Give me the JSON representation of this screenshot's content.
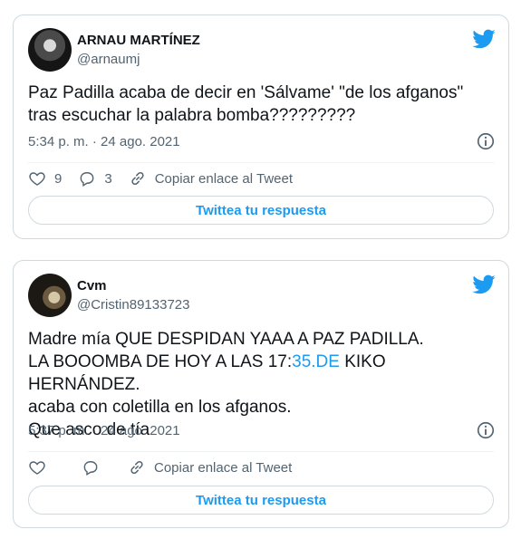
{
  "tweets": [
    {
      "author": "ARNAU MARTÍNEZ",
      "handle": "@arnaumj",
      "text": "Paz Padilla acaba de decir en 'Sálvame' \"de los afganos\"\ntras escuchar la palabra bomba?????????",
      "timestamp": "5:34 p. m. · 24 ago. 2021",
      "likes": "9",
      "replies": "3",
      "copy_link_label": "Copiar enlace al Tweet",
      "reply_button_label": "Twittea tu respuesta"
    },
    {
      "author": "Cvm",
      "handle": "@Cristin89133723",
      "text_before_link": "Madre mía QUE DESPIDAN YAAA A PAZ PADILLA.\nLA BOOOMBA DE HOY A LAS 17:",
      "link_text": "35.DE",
      "text_after_link": " KIKO HERNÁNDEZ.\nacaba con coletilla en los afganos.\nQue asco de tía",
      "timestamp": "5:37 p. m. · 24 ago. 2021",
      "copy_link_label": "Copiar enlace al Tweet",
      "reply_button_label": "Twittea tu respuesta"
    }
  ],
  "colors": {
    "accent": "#1d9bf0",
    "secondary_text": "#536471",
    "border": "#cfd9de"
  },
  "icons": [
    "twitter-bird-icon",
    "info-icon",
    "heart-icon",
    "reply-icon",
    "link-icon"
  ]
}
